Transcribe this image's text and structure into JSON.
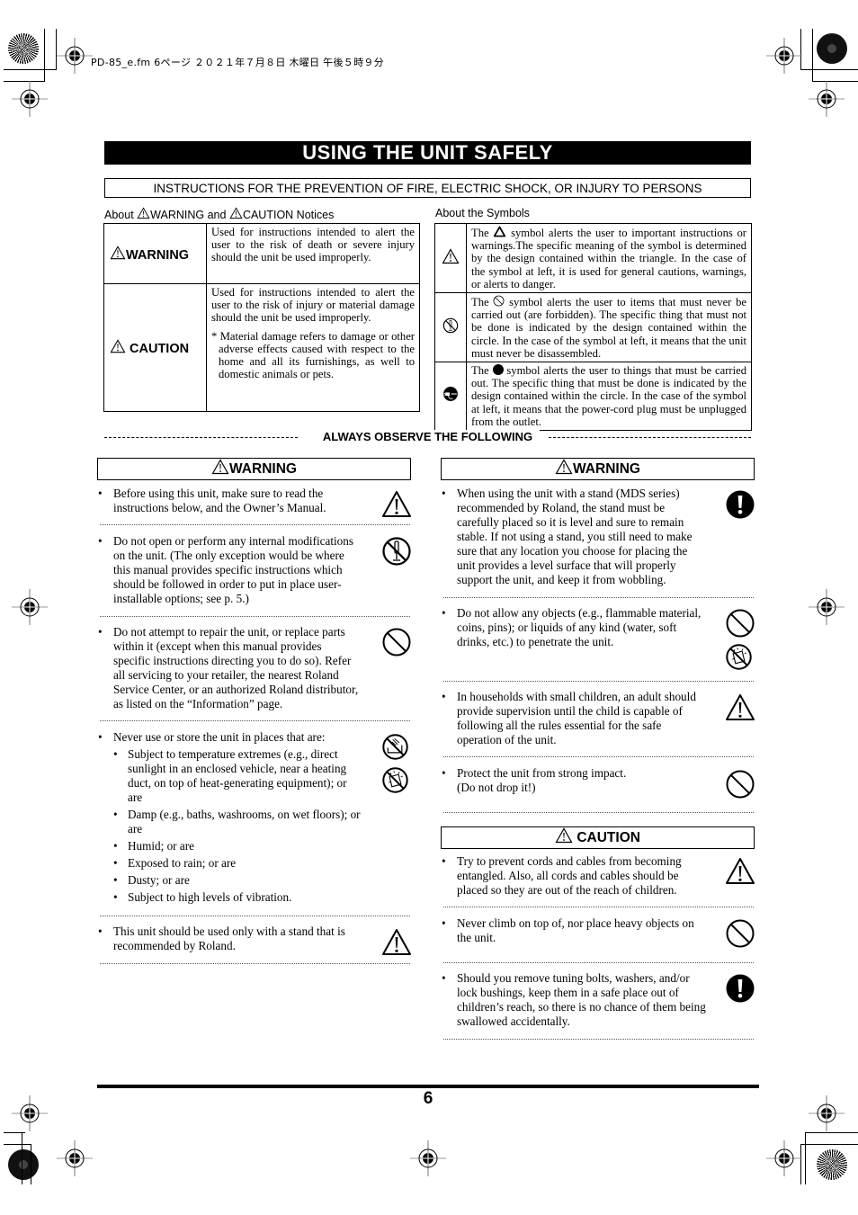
{
  "header": {
    "slug": "PD-85_e.fm  6ページ  ２０２１年７月８日  木曜日  午後５時９分"
  },
  "title": "USING THE UNIT SAFELY",
  "subtitle": "INSTRUCTIONS FOR THE PREVENTION OF FIRE, ELECTRIC SHOCK, OR INJURY TO PERSONS",
  "notices": {
    "heading_prefix": "About",
    "heading_warning": "WARNING",
    "heading_and": "and",
    "heading_caution": "CAUTION",
    "heading_suffix": "Notices",
    "rows": [
      {
        "label": "WARNING",
        "text": "Used for instructions intended to alert the user to the risk of death or severe injury should the unit be used improperly."
      },
      {
        "label": "CAUTION",
        "text": "Used for instructions intended to alert the user to the risk of injury or material damage should the unit be used improperly.",
        "note": "* Material damage refers to damage or other adverse effects caused with respect to the home and all its furnishings, as well to domestic animals or pets."
      }
    ]
  },
  "symbols": {
    "heading": "About the Symbols",
    "rows": [
      {
        "icon": "warning-triangle-icon",
        "pre": "The",
        "inline_icon": "triangle-icon",
        "text": "symbol alerts the user to important instructions or warnings.The specific meaning of the symbol is determined by the design contained within the triangle. In the case of the symbol at left, it is used for general cautions, warnings, or alerts to danger."
      },
      {
        "icon": "no-disassemble-icon",
        "pre": "The",
        "inline_icon": "prohibition-icon",
        "text": "symbol alerts the user to items that must never be carried out (are forbidden). The specific thing that must not be done is indicated by the design contained within the circle. In the case of the symbol at left, it means that the unit must never be disassembled."
      },
      {
        "icon": "unplug-icon",
        "pre": "The",
        "inline_icon": "filled-circle-icon",
        "text": "symbol alerts the user to things that must be carried out. The specific thing that must be done is indicated by the design contained within the circle. In the case of the symbol at left, it means that the power-cord plug must be unplugged from the outlet."
      }
    ]
  },
  "observe_heading": "ALWAYS OBSERVE THE FOLLOWING",
  "left_column": {
    "heading": "WARNING",
    "items": [
      {
        "lines": [
          "Before using this unit, make sure to read the",
          "instructions below, and the Owner’s Manual."
        ],
        "icons": [
          "warning-triangle-icon"
        ]
      },
      {
        "lines": [
          "Do not open or perform any internal modifications",
          "on the unit. (The only exception would be where",
          "this manual provides specific instructions which",
          "should be followed in order to put in place user-",
          "installable options; see p. 5.)"
        ],
        "icons": [
          "no-disassemble-icon"
        ]
      },
      {
        "lines": [
          "Do not attempt to repair the unit, or replace parts",
          "within it (except when this manual provides",
          "specific instructions directing you to do so). Refer",
          "all servicing to your retailer, the nearest Roland",
          "Service Center, or an authorized Roland distributor,",
          "as listed on the “Information” page."
        ],
        "icons": [
          "prohibition-icon"
        ]
      },
      {
        "lines": [
          "Never use or store the unit in places that are:"
        ],
        "icons": [
          "no-wet-location-icon",
          "no-liquid-icon"
        ],
        "subitems": [
          [
            "Subject to temperature extremes (e.g., direct",
            "sunlight in an enclosed vehicle, near a heating",
            "duct, on top of heat-generating equipment); or",
            "are"
          ],
          [
            "Damp (e.g., baths, washrooms, on wet floors); or",
            "are"
          ],
          [
            "Humid; or are"
          ],
          [
            "Exposed to rain; or are"
          ],
          [
            "Dusty; or are"
          ],
          [
            "Subject to high levels of vibration."
          ]
        ]
      },
      {
        "lines": [
          "This unit should be used only with a stand that is",
          "recommended by Roland."
        ],
        "icons": [
          "warning-triangle-icon"
        ]
      }
    ]
  },
  "right_column": {
    "warning_heading": "WARNING",
    "warning_items": [
      {
        "lines": [
          "When using the unit with a stand (MDS series)",
          "recommended by Roland, the stand must be",
          "carefully placed so it is level and sure to remain",
          "stable. If not using a stand, you still need to make",
          "sure that any location you choose for placing the",
          "unit provides a level surface that will properly",
          "support the unit, and keep it from wobbling."
        ],
        "icons": [
          "mandatory-icon"
        ]
      },
      {
        "lines": [
          "Do not allow any objects (e.g., flammable material,",
          "coins, pins); or liquids of any kind (water, soft",
          "drinks, etc.) to penetrate the unit."
        ],
        "icons": [
          "prohibition-icon",
          "no-liquid-icon"
        ]
      },
      {
        "lines": [
          "In households with small children, an adult should",
          "provide supervision until the child is capable of",
          "following all the rules essential for the safe",
          "operation of the unit."
        ],
        "icons": [
          "warning-triangle-icon"
        ]
      },
      {
        "lines": [
          "Protect the unit from strong impact.",
          "(Do not drop it!)"
        ],
        "icons": [
          "prohibition-icon"
        ]
      }
    ],
    "caution_heading": "CAUTION",
    "caution_items": [
      {
        "lines": [
          "Try to prevent cords and cables from becoming",
          "entangled. Also, all cords and cables should be",
          "placed so they are out of the reach of children."
        ],
        "icons": [
          "warning-triangle-icon"
        ]
      },
      {
        "lines": [
          "Never climb on top of, nor place heavy objects on",
          "the unit."
        ],
        "icons": [
          "prohibition-icon"
        ]
      },
      {
        "lines": [
          "Should you remove tuning bolts, washers, and/or",
          "lock bushings, keep them in a safe place out of",
          "children’s reach, so there is no chance of them being",
          "swallowed accidentally."
        ],
        "icons": [
          "mandatory-icon"
        ]
      }
    ]
  },
  "footer": {
    "page_number": "6"
  }
}
